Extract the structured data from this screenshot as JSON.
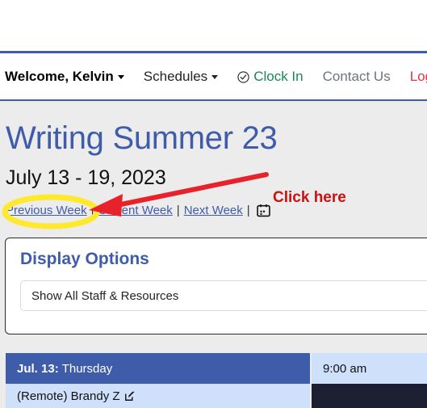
{
  "navbar": {
    "welcome": "Welcome, Kelvin",
    "schedules": "Schedules",
    "clock_in": "Clock In",
    "clock_in_icon": "circle-check-icon",
    "contact_us": "Contact Us",
    "log_out": "Log Out",
    "colors": {
      "clock_in": "#198754",
      "contact_us": "#6c757d",
      "log_out": "#dc3545",
      "rule": "#3f5cab"
    }
  },
  "main": {
    "title": "Writing Summer 23",
    "date_range": "July 13 - 19, 2023",
    "title_color": "#3f5cab"
  },
  "week_nav": {
    "previous": "Previous Week",
    "current": "Current Week",
    "next": "Next Week",
    "separator": "|",
    "calendar_icon": "calendar-icon"
  },
  "display_options": {
    "heading": "Display Options",
    "select_value": "Show All Staff & Resources"
  },
  "schedule": {
    "day_label_bold": "Jul. 13:",
    "day_label": "Thursday",
    "time": "9:00 am",
    "staff_name": "(Remote) Brandy Z",
    "edit_icon": "edit-square-icon",
    "header_color": "#3f5cab",
    "cell_color": "#cfe0fb"
  },
  "annotation": {
    "label": "Click here",
    "color": "#cc1111",
    "highlight_color": "#ffe92e",
    "target": "Previous Week"
  }
}
